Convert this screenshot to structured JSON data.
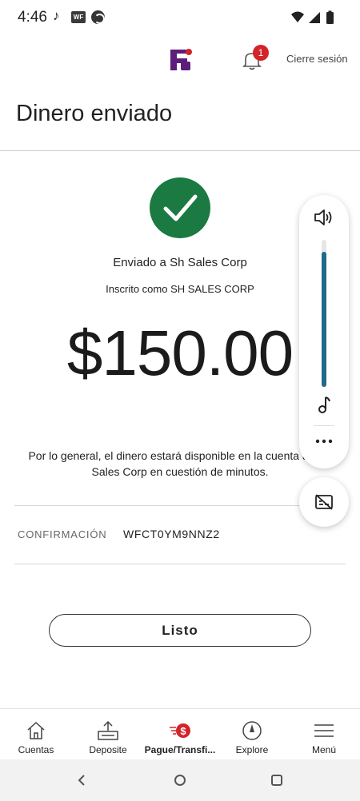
{
  "status_bar": {
    "time": "4:46",
    "wf_badge": "WF",
    "icons": [
      "tiktok-icon",
      "wf-icon",
      "app-icon",
      "wifi-icon",
      "signal-icon",
      "battery-icon"
    ]
  },
  "header": {
    "notification_count": "1",
    "logout_label": "Cierre sesión",
    "brand_color": "#5c1e7a",
    "badge_color": "#d3222a"
  },
  "page": {
    "title": "Dinero enviado"
  },
  "confirmation": {
    "sent_to": "Enviado a Sh Sales Corp",
    "registered_as": "Inscrito como SH SALES CORP",
    "amount": "$150.00",
    "availability_line1": "Por lo general, el dinero estará disponible en la cuenta de Sh",
    "availability_line2": "Sales Corp en cuestión de minutos.",
    "confirmation_label": "CONFIRMACIÓN",
    "confirmation_number": "WFCT0YM9NNZ2",
    "done_button": "Listo",
    "success_color": "#1a7a42"
  },
  "volume_overlay": {
    "level": 0.92,
    "icons": [
      "speaker-icon",
      "music-note-icon",
      "more-icon",
      "captions-off-icon"
    ]
  },
  "bottom_nav": {
    "items": [
      {
        "label": "Cuentas",
        "icon": "home-icon"
      },
      {
        "label": "Deposite",
        "icon": "deposit-icon"
      },
      {
        "label": "Pague/Transfi...",
        "icon": "pay-transfer-icon"
      },
      {
        "label": "Explore",
        "icon": "compass-icon"
      },
      {
        "label": "Menú",
        "icon": "menu-icon"
      }
    ],
    "active_index": 2
  },
  "system_nav": {
    "icons": [
      "back-icon",
      "home-circle-icon",
      "recents-icon"
    ]
  }
}
